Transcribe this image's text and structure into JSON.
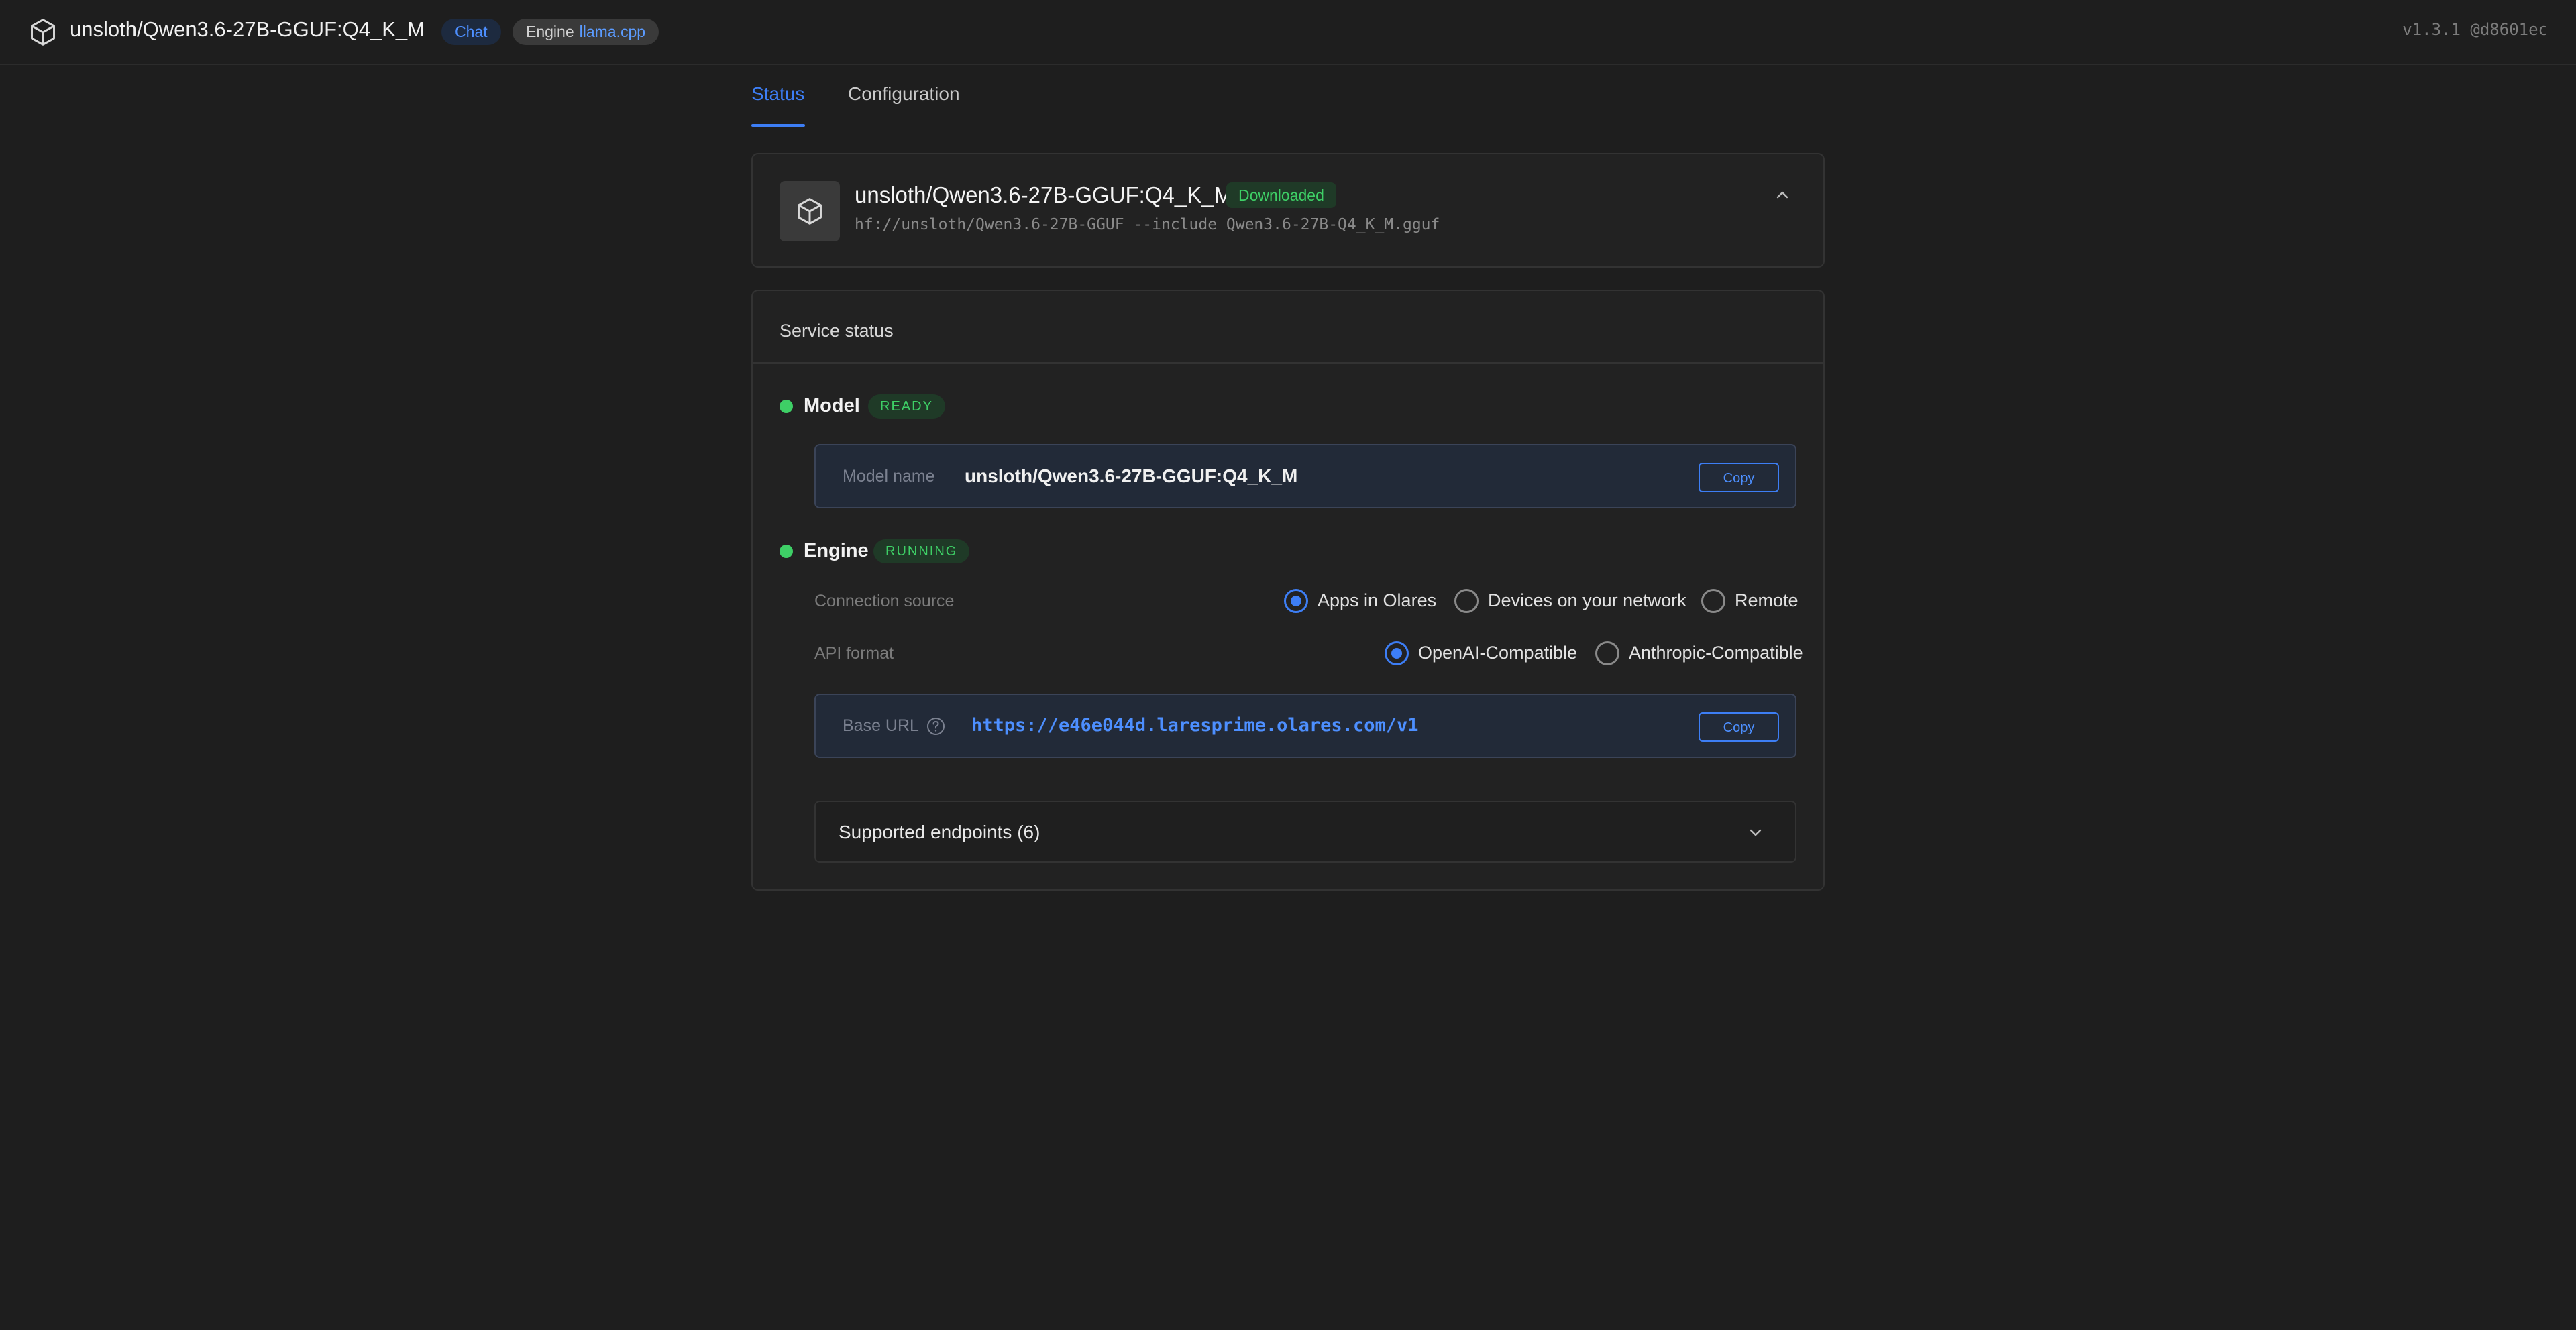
{
  "header": {
    "title": "unsloth/Qwen3.6-27B-GGUF:Q4_K_M",
    "chat_pill": "Chat",
    "engine_label": "Engine",
    "engine_value": "llama.cpp",
    "version": "v1.3.1 @d8601ec",
    "logo_icon": "cube-icon"
  },
  "tabs": [
    {
      "label": "Status",
      "active": true
    },
    {
      "label": "Configuration",
      "active": false
    }
  ],
  "model_card": {
    "title": "unsloth/Qwen3.6-27B-GGUF:Q4_K_M",
    "badge": "Downloaded",
    "source": "hf://unsloth/Qwen3.6-27B-GGUF --include Qwen3.6-27B-Q4_K_M.gguf",
    "icon": "cube-icon",
    "toggle_icon": "chevron-up-icon"
  },
  "service": {
    "title": "Service status",
    "model": {
      "label": "Model",
      "status": "READY",
      "field_label": "Model name",
      "field_value": "unsloth/Qwen3.6-27B-GGUF:Q4_K_M",
      "copy_label": "Copy"
    },
    "engine": {
      "label": "Engine",
      "status": "RUNNING",
      "connection_label": "Connection source",
      "connection_options": [
        {
          "label": "Apps in Olares",
          "checked": true
        },
        {
          "label": "Devices on your network",
          "checked": false
        },
        {
          "label": "Remote",
          "checked": false
        }
      ],
      "api_label": "API format",
      "api_options": [
        {
          "label": "OpenAI-Compatible",
          "checked": true
        },
        {
          "label": "Anthropic-Compatible",
          "checked": false
        }
      ],
      "base_url_label": "Base URL",
      "base_url": "https://e46e044d.laresprime.olares.com/v1",
      "copy_label": "Copy"
    },
    "endpoints_label": "Supported endpoints (6)"
  },
  "colors": {
    "accent": "#3d7ef5",
    "success": "#3ecf66",
    "background": "#1e1e1e"
  }
}
